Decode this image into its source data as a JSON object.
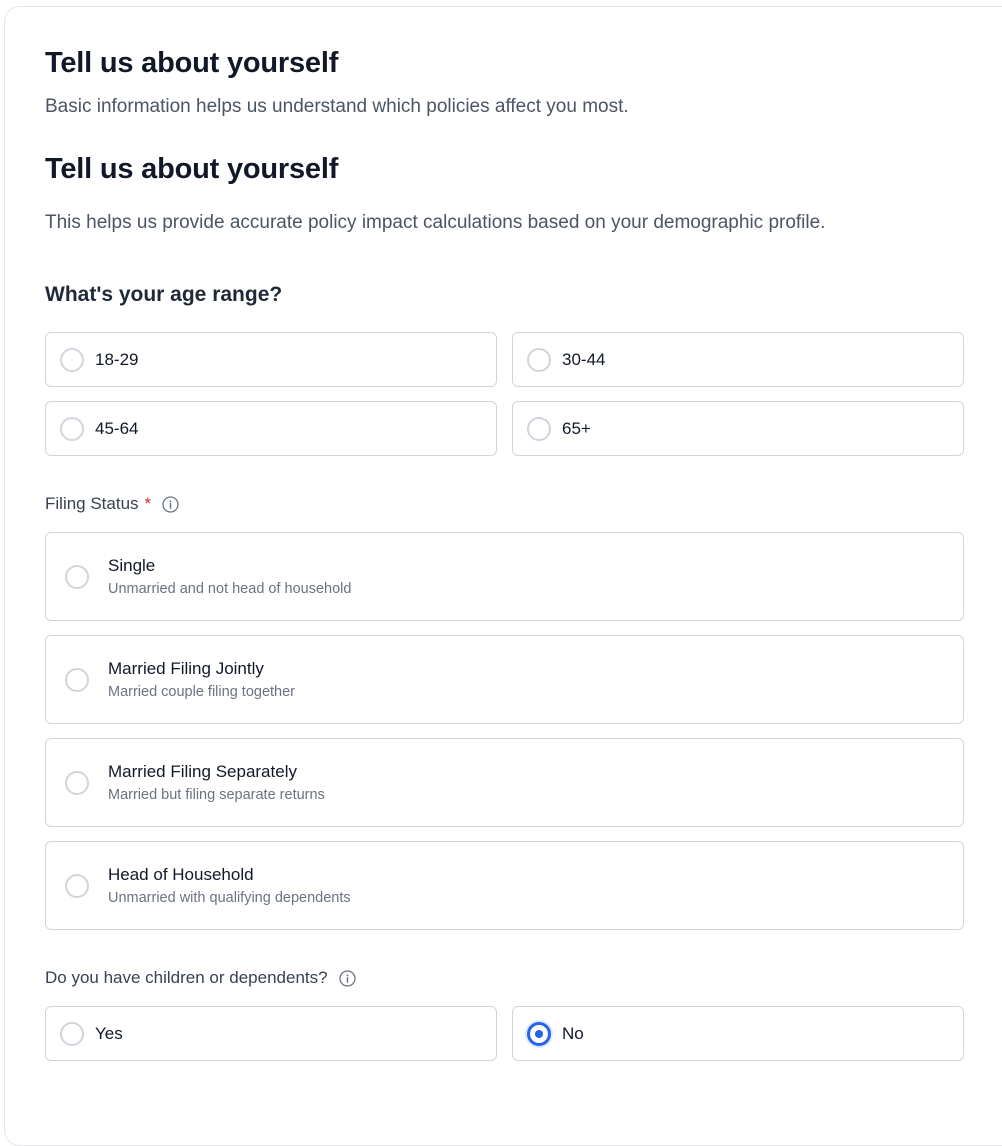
{
  "section": {
    "heading": "Tell us about yourself",
    "description": "Basic information helps us understand which policies affect you most."
  },
  "step": {
    "heading": "Tell us about yourself",
    "description": "This helps us provide accurate policy impact calculations based on your demographic profile."
  },
  "age": {
    "question": "What's your age range?",
    "options": [
      {
        "label": "18-29",
        "selected": false
      },
      {
        "label": "30-44",
        "selected": false
      },
      {
        "label": "45-64",
        "selected": false
      },
      {
        "label": "65+",
        "selected": false
      }
    ]
  },
  "filing": {
    "label": "Filing Status",
    "required_mark": "*",
    "options": [
      {
        "title": "Single",
        "description": "Unmarried and not head of household",
        "selected": false
      },
      {
        "title": "Married Filing Jointly",
        "description": "Married couple filing together",
        "selected": false
      },
      {
        "title": "Married Filing Separately",
        "description": "Married but filing separate returns",
        "selected": false
      },
      {
        "title": "Head of Household",
        "description": "Unmarried with qualifying dependents",
        "selected": false
      }
    ]
  },
  "dependents": {
    "question": "Do you have children or dependents?",
    "options": [
      {
        "label": "Yes",
        "selected": false
      },
      {
        "label": "No",
        "selected": true
      }
    ]
  },
  "colors": {
    "accent": "#2563eb",
    "required": "#dc2626",
    "border": "#d1d5db"
  },
  "icons": {
    "info": "info-circle-icon"
  }
}
